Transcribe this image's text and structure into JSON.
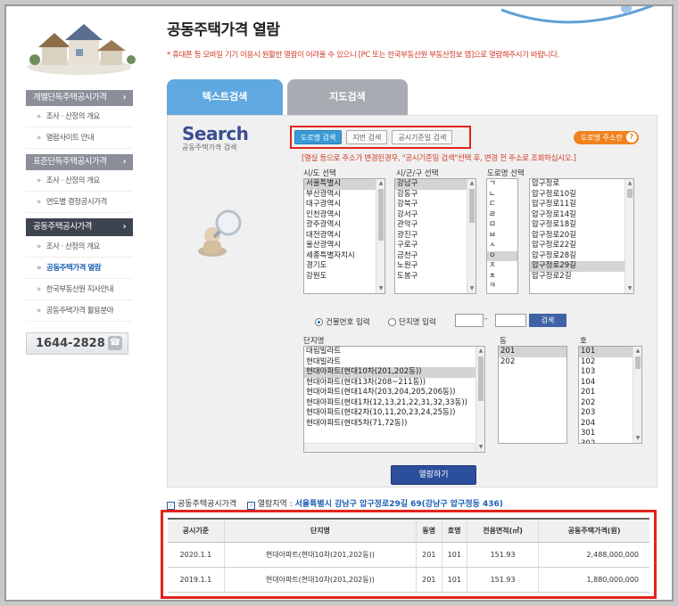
{
  "page": {
    "title": "공동주택가격 열람",
    "notice": "* 휴대폰 등 모바일 기기 이용시 원활한 열람이 어려울 수 있으니 [PC 또는 한국부동산원 부동산정보 앱]으로 열람해주시기 바랍니다."
  },
  "sidebar": {
    "sections": [
      {
        "title": "개별단독주택공시가격",
        "items": [
          "조사 · 산정의 개요",
          "열람사이트 안내"
        ]
      },
      {
        "title": "표준단독주택공시가격",
        "items": [
          "조사 · 산정의 개요",
          "연도별 결정공시가격"
        ]
      },
      {
        "title": "공동주택공시가격",
        "items": [
          "조사 · 산정의 개요",
          "공동주택가격 열람",
          "한국부동산원 지사안내",
          "공동주택가격 활용분야"
        ]
      }
    ],
    "phone": "1644-2828"
  },
  "tabs": {
    "text_search": "텍스트검색",
    "map_search": "지도검색"
  },
  "search": {
    "logo_big": "Search",
    "logo_sub": "공동주택가격 검색",
    "mode_buttons": [
      "도로명 검색",
      "지번 검색",
      "공시기준일 검색"
    ],
    "road_help": "도로명 주소란",
    "road_help_q": "?",
    "warning": "[멸실 등으로 주소가 변경된경우, \"공시기준일 검색\"선택 후, 변경 전 주소로 조회하십시오.]",
    "sido_label": "시/도 선택",
    "sido": [
      "서울특별시",
      "부산광역시",
      "대구광역시",
      "인천광역시",
      "광주광역시",
      "대전광역시",
      "울산광역시",
      "세종특별자치시",
      "경기도",
      "강원도"
    ],
    "sigungu_label": "시/군/구 선택",
    "sigungu": [
      "강남구",
      "강동구",
      "강북구",
      "강서구",
      "관악구",
      "광진구",
      "구로구",
      "금천구",
      "노원구",
      "도봉구"
    ],
    "road_label": "도로명 선택",
    "initials": [
      "ㄱ",
      "ㄴ",
      "ㄷ",
      "ㄹ",
      "ㅁ",
      "ㅂ",
      "ㅅ",
      "ㅇ",
      "ㅈ",
      "ㅊ",
      "ㅋ",
      "ㅌ",
      "ㅎ"
    ],
    "roads": [
      "압구정로",
      "압구정로10길",
      "압구정로11길",
      "압구정로14길",
      "압구정로18길",
      "압구정로20길",
      "압구정로22길",
      "압구정로28길",
      "압구정로29길",
      "압구정로2길"
    ],
    "radio_bldg": "건물번호 입력",
    "radio_complex": "단지명 입력",
    "dash": "-",
    "search_btn": "검색",
    "complex_label": "단지명",
    "complexes": [
      "대림빌라트",
      "현대빌라트",
      "현대아파트(현대10차(201,202동))",
      "현대아파트(현대13차(208~211동))",
      "현대아파트(현대14차(203,204,205,206동))",
      "현대아파트(현대1차(12,13,21,22,31,32,33동))",
      "현대아파트(현대2차(10,11,20,23,24,25동))",
      "현대아파트(현대5차(71,72동))"
    ],
    "dong_label": "동",
    "dongs": [
      "201",
      "202"
    ],
    "ho_label": "호",
    "hos": [
      "101",
      "102",
      "103",
      "104",
      "201",
      "202",
      "203",
      "204",
      "301",
      "302"
    ],
    "view_btn": "열람하기"
  },
  "breadcrumb": {
    "section": "공동주택공시가격",
    "prefix": "열람지역 :",
    "address": "서울특별시 강남구 압구정로29길 69(강남구 압구정동 436)"
  },
  "table": {
    "headers": [
      "공시기준",
      "단지명",
      "동명",
      "호명",
      "전용면적(㎡)",
      "공동주택가격(원)"
    ],
    "rows": [
      [
        "2020.1.1",
        "현대아파트(현대10차(201,202동))",
        "201",
        "101",
        "151.93",
        "2,488,000,000"
      ],
      [
        "2019.1.1",
        "현대아파트(현대10차(201,202동))",
        "201",
        "101",
        "151.93",
        "1,880,000,000"
      ]
    ]
  }
}
